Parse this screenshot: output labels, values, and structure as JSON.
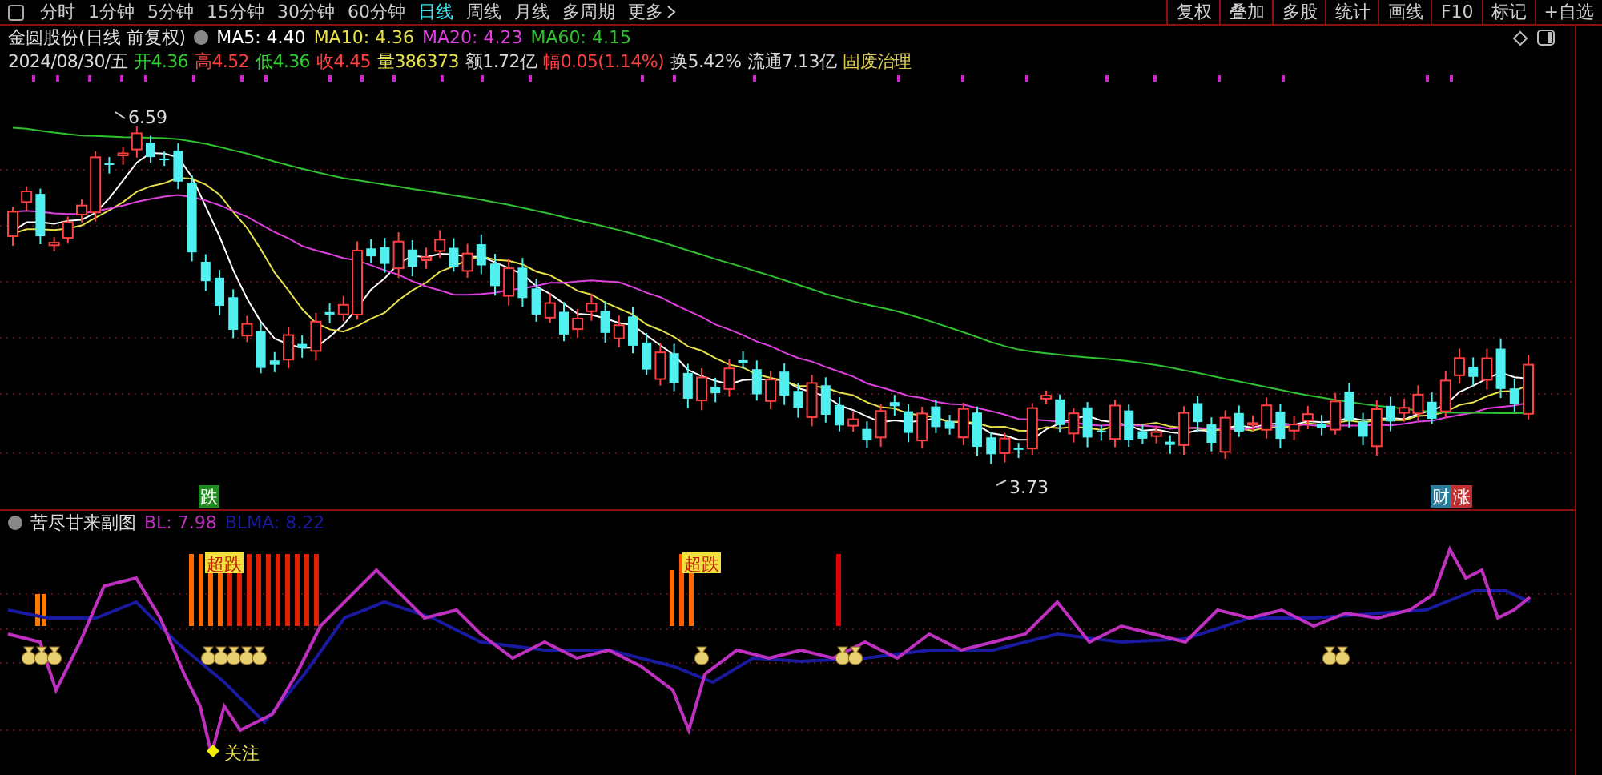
{
  "toolbar": {
    "periods": [
      {
        "label": "分时",
        "selected": false
      },
      {
        "label": "1分钟",
        "selected": false
      },
      {
        "label": "5分钟",
        "selected": false
      },
      {
        "label": "15分钟",
        "selected": false
      },
      {
        "label": "30分钟",
        "selected": false
      },
      {
        "label": "60分钟",
        "selected": false
      },
      {
        "label": "日线",
        "selected": true
      },
      {
        "label": "周线",
        "selected": false
      },
      {
        "label": "月线",
        "selected": false
      },
      {
        "label": "多周期",
        "selected": false
      },
      {
        "label": "更多",
        "selected": false
      }
    ],
    "tools": [
      "复权",
      "叠加",
      "多股",
      "统计",
      "画线",
      "F10",
      "标记",
      "+自选"
    ]
  },
  "main_chart": {
    "title": "金圆股份(日线 前复权)",
    "moving_averages": [
      {
        "label": "MA5: 4.40",
        "color": "#ffffff"
      },
      {
        "label": "MA10: 4.36",
        "color": "#e8e04a"
      },
      {
        "label": "MA20: 4.23",
        "color": "#e040e0"
      },
      {
        "label": "MA60: 4.15",
        "color": "#30c030"
      }
    ],
    "quote": [
      {
        "text": "2024/08/30/五",
        "color": "#d8d8d8"
      },
      {
        "text": "开4.36",
        "color": "#30d030"
      },
      {
        "text": "高4.52",
        "color": "#ff4040"
      },
      {
        "text": "低4.36",
        "color": "#30d030"
      },
      {
        "text": "收4.45",
        "color": "#ff4040"
      },
      {
        "text": "量386373",
        "color": "#e8e04a"
      },
      {
        "text": "额1.72亿",
        "color": "#d8d8d8"
      },
      {
        "text": "幅0.05(1.14%)",
        "color": "#ff4040"
      },
      {
        "text": "换5.42%",
        "color": "#d8d8d8"
      },
      {
        "text": "流通7.13亿",
        "color": "#d8d8d8"
      },
      {
        "text": "固废治理",
        "color": "#d8c850"
      }
    ],
    "high_label": "6.59",
    "low_label": "3.73",
    "markers": [
      {
        "text": "跌",
        "color": "#208a20"
      },
      {
        "text": "财",
        "color": "#2a7a9a"
      },
      {
        "text": "涨",
        "color": "#c03030"
      }
    ]
  },
  "sub_chart": {
    "title": "苦尽甘来副图",
    "readings": [
      {
        "text": "BL: 7.98",
        "color": "#c030c0"
      },
      {
        "text": "BLMA: 8.22",
        "color": "#1a1aa0"
      }
    ],
    "signals": [
      "超跌",
      "超跌"
    ],
    "focus_label": "关注"
  }
}
